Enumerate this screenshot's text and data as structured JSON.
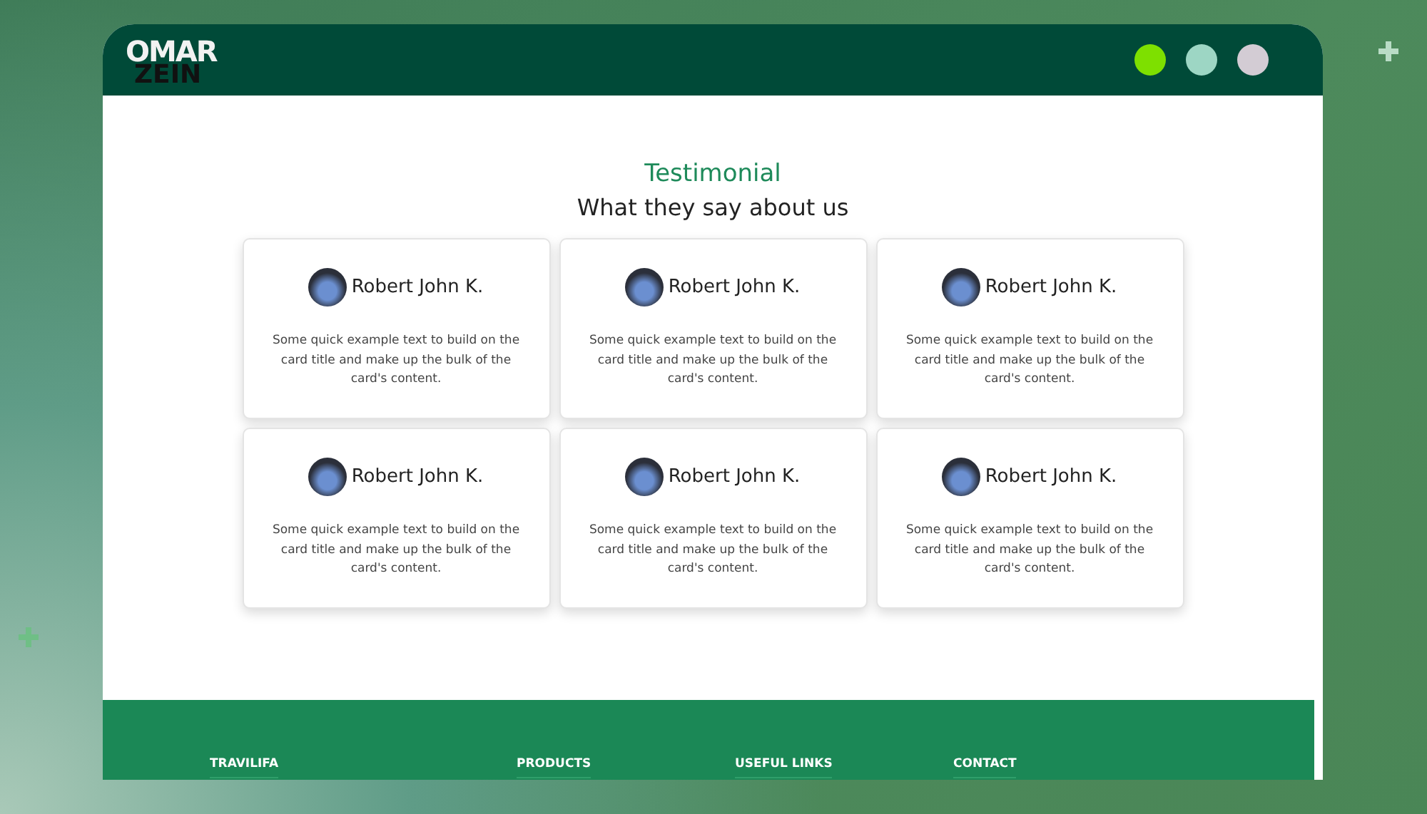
{
  "header": {
    "logo": {
      "top": "OMAR",
      "bottom": "ZEIN"
    },
    "dots": [
      {
        "color": "#7ee000"
      },
      {
        "color": "#9dd6c4"
      },
      {
        "color": "#d3ccd4"
      }
    ]
  },
  "section": {
    "eyebrow": "Testimonial",
    "heading": "What they say about us"
  },
  "cards": [
    {
      "name": "Robert John K.",
      "text": "Some quick example text to build on the card title and make up the bulk of the card's content."
    },
    {
      "name": "Robert John K.",
      "text": "Some quick example text to build on the card title and make up the bulk of the card's content."
    },
    {
      "name": "Robert John K.",
      "text": "Some quick example text to build on the card title and make up the bulk of the card's content."
    },
    {
      "name": "Robert John K.",
      "text": "Some quick example text to build on the card title and make up the bulk of the card's content."
    },
    {
      "name": "Robert John K.",
      "text": "Some quick example text to build on the card title and make up the bulk of the card's content."
    },
    {
      "name": "Robert John K.",
      "text": "Some quick example text to build on the card title and make up the bulk of the card's content."
    }
  ],
  "footer": {
    "columns": [
      "TRAVILIFA",
      "PRODUCTS",
      "USEFUL LINKS",
      "CONTACT"
    ]
  }
}
